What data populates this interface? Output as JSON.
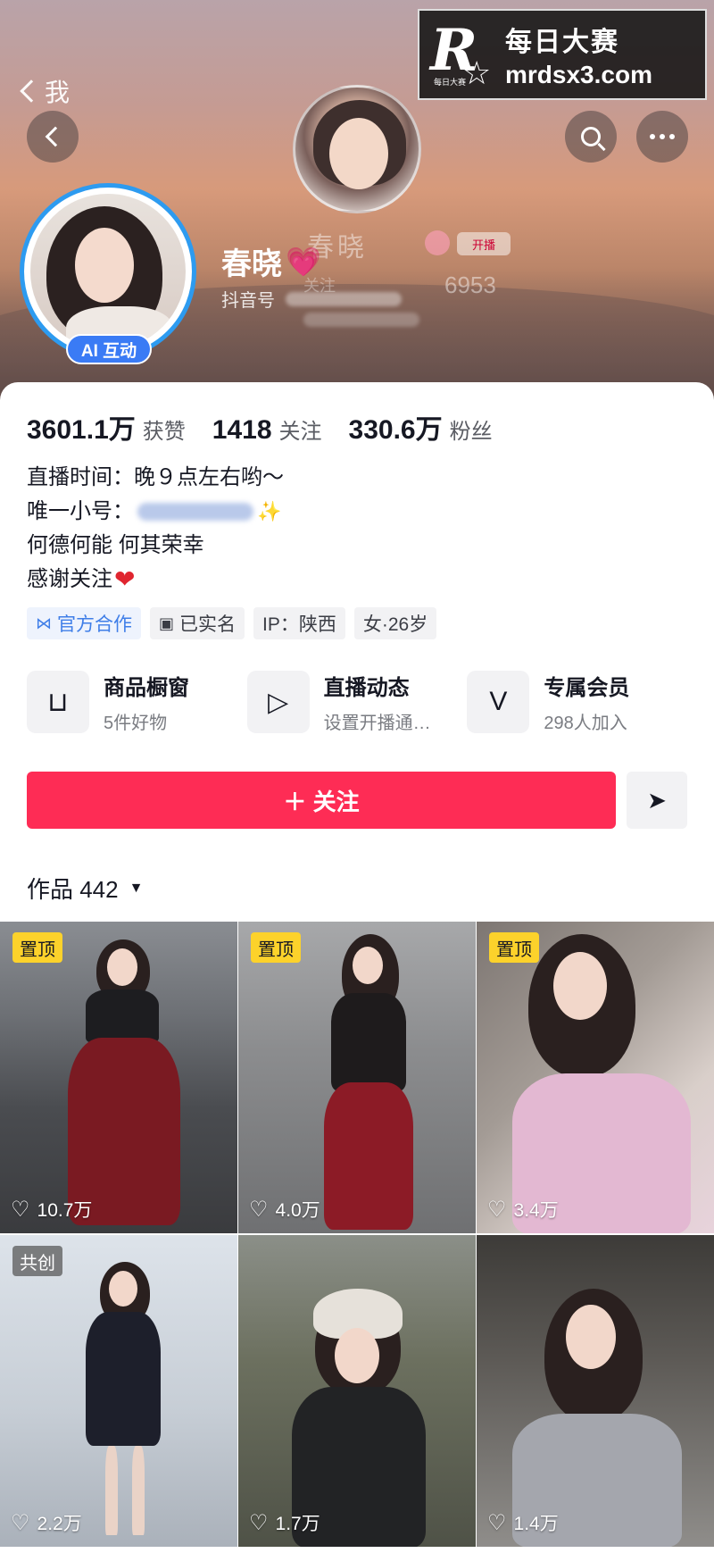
{
  "header": {
    "ghost_back_label": "我",
    "nickname": "春晓",
    "nickname_emoji": "💗",
    "douyin_id_label": "抖音号",
    "ai_badge": "AI 互动",
    "ghost_follow_label": "关注",
    "ghost_count": "6953",
    "ghost_badge": "开播"
  },
  "watermark": {
    "logo_letter": "R",
    "logo_small": "每日大赛",
    "title": "每日大赛",
    "url": "mrdsx3.com"
  },
  "stats": [
    {
      "num": "3601.1万",
      "label": "获赞"
    },
    {
      "num": "1418",
      "label": "关注"
    },
    {
      "num": "330.6万",
      "label": "粉丝"
    }
  ],
  "bio": {
    "live_time": "直播时间：晚９点左右哟～",
    "alt_account_label": "唯一小号：",
    "line3": "何德何能 何其荣幸",
    "line4": "感谢关注",
    "heart": "❤"
  },
  "tags": [
    {
      "label": "官方合作",
      "icon": "⋈"
    },
    {
      "label": "已实名",
      "icon": "▣"
    },
    {
      "label": "IP：陕西",
      "icon": ""
    },
    {
      "label": "女·26岁",
      "icon": ""
    }
  ],
  "services": [
    {
      "title": "商品橱窗",
      "sub": "5件好物",
      "icon": "shopping-bag-icon",
      "glyph": "⊔"
    },
    {
      "title": "直播动态",
      "sub": "设置开播通…",
      "icon": "tv-icon",
      "glyph": "▷"
    },
    {
      "title": "专属会员",
      "sub": "298人加入",
      "icon": "v-icon",
      "glyph": "V"
    }
  ],
  "actions": {
    "follow_label": "＋ 关注",
    "share_glyph": "➤"
  },
  "works": {
    "label": "作品 442",
    "tiles": [
      {
        "badge": "置顶",
        "likes": "10.7万"
      },
      {
        "badge": "置顶",
        "likes": "4.0万"
      },
      {
        "badge": "置顶",
        "likes": "3.4万"
      },
      {
        "badge": "共创",
        "likes": "2.2万"
      },
      {
        "badge": "",
        "likes": "1.7万"
      },
      {
        "badge": "",
        "likes": "1.4万"
      }
    ]
  },
  "colors": {
    "accent": "#fe2c55",
    "pin_yellow": "#fcd22b",
    "ai_blue": "#3a7bf5",
    "official_blue": "#3f7ee8"
  }
}
